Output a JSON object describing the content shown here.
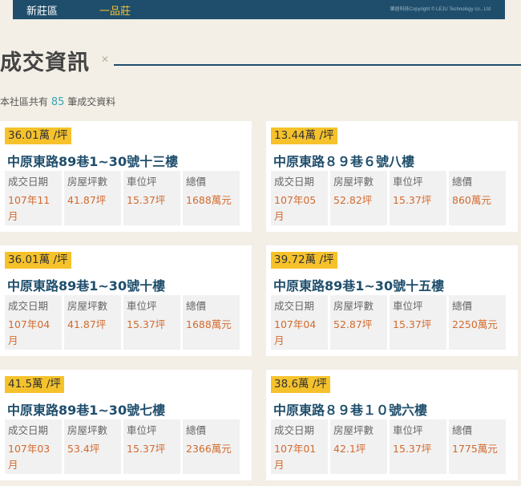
{
  "breadcrumb": {
    "district": "新莊區",
    "community": "一品莊"
  },
  "copyright": "樂居科技Copyright © LEJU Technology co., Ltd",
  "section": {
    "title": "成交資訊",
    "deco": "✕"
  },
  "summary": {
    "prefix": "本社區共有",
    "count": "85",
    "suffix": "筆成交資料"
  },
  "stat_labels": {
    "date": "成交日期",
    "area": "房屋坪數",
    "parking": "車位坪",
    "total": "總價"
  },
  "transactions": [
    {
      "price": "36.01萬 /坪",
      "address": "中原東路89巷1~30號十三樓",
      "date": "107年11月",
      "area": "41.87坪",
      "parking": "15.37坪",
      "total": "1688萬元"
    },
    {
      "price": "13.44萬 /坪",
      "address": "中原東路８９巷６號八樓",
      "date": "107年05月",
      "area": "52.82坪",
      "parking": "15.37坪",
      "total": "860萬元"
    },
    {
      "price": "36.01萬 /坪",
      "address": "中原東路89巷1~30號十樓",
      "date": "107年04月",
      "area": "41.87坪",
      "parking": "15.37坪",
      "total": "1688萬元"
    },
    {
      "price": "39.72萬 /坪",
      "address": "中原東路89巷1~30號十五樓",
      "date": "107年04月",
      "area": "52.87坪",
      "parking": "15.37坪",
      "total": "2250萬元"
    },
    {
      "price": "41.5萬 /坪",
      "address": "中原東路89巷1~30號七樓",
      "date": "107年03月",
      "area": "53.4坪",
      "parking": "15.37坪",
      "total": "2366萬元"
    },
    {
      "price": "38.6萬 /坪",
      "address": "中原東路８９巷１０號六樓",
      "date": "107年01月",
      "area": "42.1坪",
      "parking": "15.37坪",
      "total": "1775萬元"
    }
  ]
}
